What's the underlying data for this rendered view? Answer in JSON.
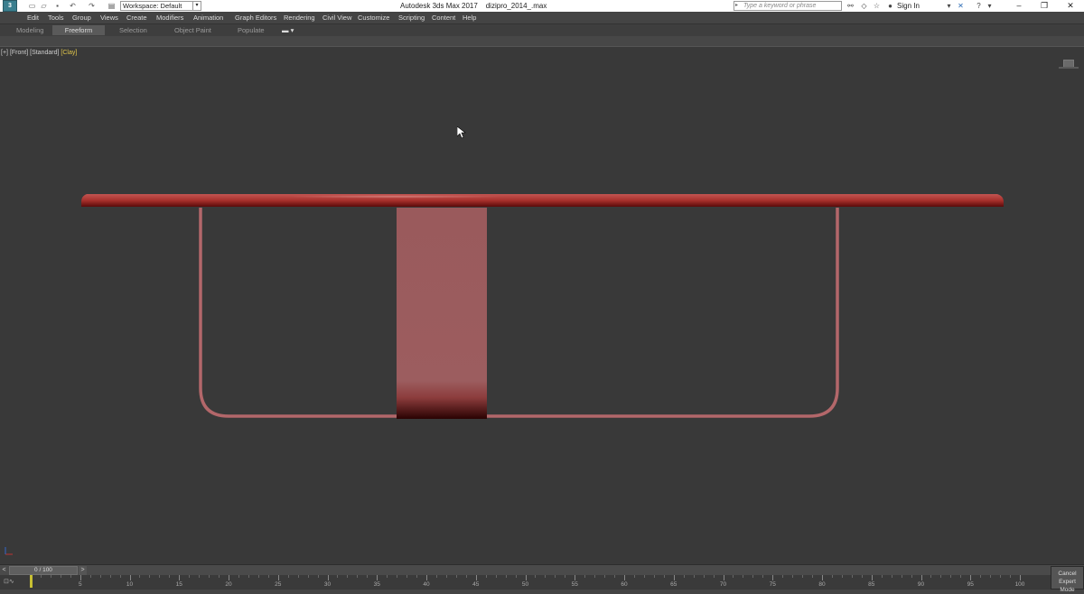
{
  "window": {
    "app_title": "Autodesk 3ds Max 2017",
    "file_name": "dizipro_2014_.max",
    "workspace_label": "Workspace: Default",
    "search_placeholder": "Type a keyword or phrase",
    "sign_in": "Sign In"
  },
  "menu": [
    "Edit",
    "Tools",
    "Group",
    "Views",
    "Create",
    "Modifiers",
    "Animation",
    "Graph Editors",
    "Rendering",
    "Civil View",
    "Customize",
    "Scripting",
    "Content",
    "Help"
  ],
  "ribbon_tabs": [
    {
      "label": "Modeling",
      "active": false
    },
    {
      "label": "Freeform",
      "active": true
    },
    {
      "label": "Selection",
      "active": false
    },
    {
      "label": "Object Paint",
      "active": false
    },
    {
      "label": "Populate",
      "active": false
    }
  ],
  "viewport": {
    "label_plus": "[+]",
    "label_view": "[Front]",
    "label_shading_std": "[Standard]",
    "label_clay": "[Clay]",
    "object_color": "#b0474a"
  },
  "timeline": {
    "frame_readout": "0 / 100",
    "prev": "<",
    "next": ">",
    "ruler_labels": [
      "5",
      "10",
      "15",
      "20",
      "25",
      "30",
      "35",
      "40",
      "45",
      "50",
      "55",
      "60",
      "65",
      "70",
      "75",
      "80",
      "85",
      "90",
      "95",
      "100"
    ],
    "current_frame": 0
  },
  "expert_mode": {
    "line1": "Cancel",
    "line2": "Expert Mode"
  }
}
